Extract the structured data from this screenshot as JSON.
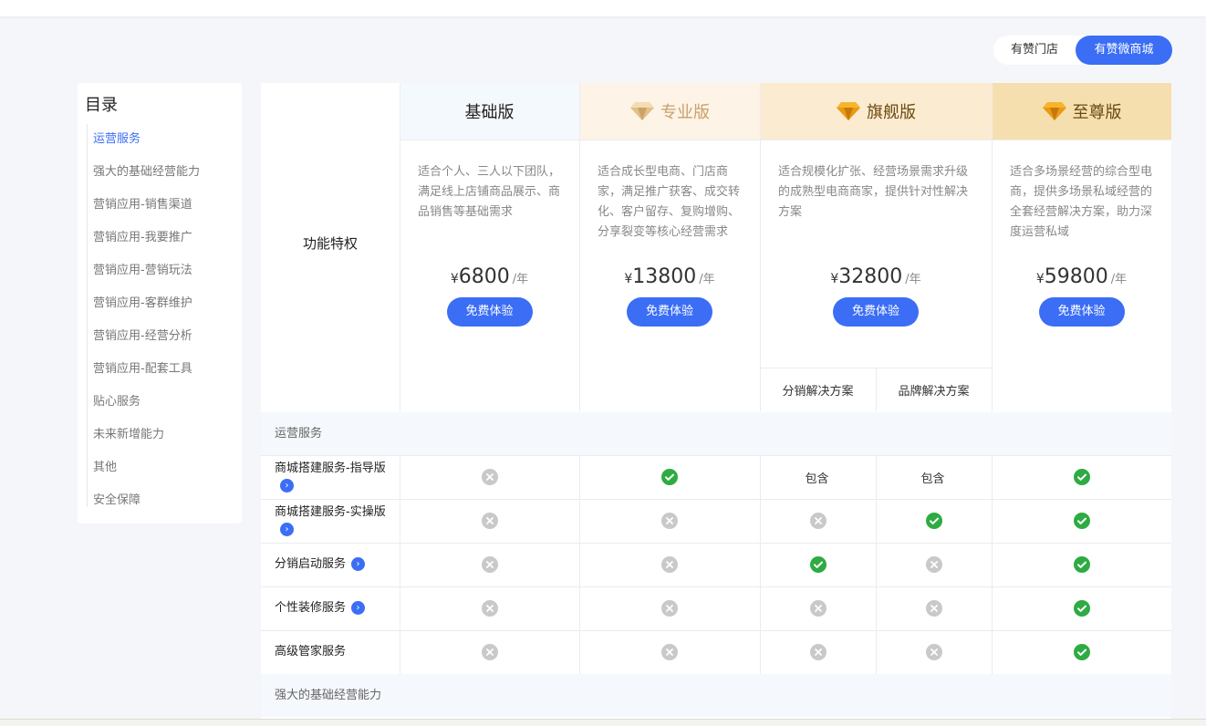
{
  "switcher": {
    "store": "有赞门店",
    "mall": "有赞微商城"
  },
  "toc": {
    "title": "目录",
    "items": [
      "运营服务",
      "强大的基础经营能力",
      "营销应用-销售渠道",
      "营销应用-我要推广",
      "营销应用-营销玩法",
      "营销应用-客群维护",
      "营销应用-经营分析",
      "营销应用-配套工具",
      "贴心服务",
      "未来新增能力",
      "其他",
      "安全保障"
    ]
  },
  "table": {
    "feature_header": "功能特权",
    "try_button": "免费体验",
    "plans": [
      {
        "name": "基础版",
        "desc": "适合个人、三人以下团队，满足线上店铺商品展示、商品销售等基础需求",
        "currency": "¥",
        "price": "6800",
        "unit": "/年",
        "header_bg": "#f4f9fd",
        "icon": ""
      },
      {
        "name": "专业版",
        "desc": "适合成长型电商、门店商家，满足推广获客、成交转化、客户留存、复购增购、分享裂变等核心经营需求",
        "currency": "¥",
        "price": "13800",
        "unit": "/年",
        "header_bg": "#fdf3e6",
        "icon": "diamond-icon"
      },
      {
        "name": "旗舰版",
        "desc": "适合规模化扩张、经营场景需求升级的成熟型电商商家，提供针对性解决方案",
        "currency": "¥",
        "price": "32800",
        "unit": "/年",
        "header_bg": "#fbebd0",
        "icon": "diamond-icon"
      },
      {
        "name": "至尊版",
        "desc": "适合多场景经营的综合型电商，提供多场景私域经营的全套经营解决方案，助力深度运营私域",
        "currency": "¥",
        "price": "59800",
        "unit": "/年",
        "header_bg": "#f6dfae",
        "icon": "diamond-icon"
      }
    ],
    "flagship_sub": [
      "分销解决方案",
      "品牌解决方案"
    ],
    "sections": [
      {
        "title": "运营服务",
        "rows": [
          {
            "label": "商城搭建服务-指导版",
            "info": true,
            "values": [
              "no",
              "yes",
              "包含",
              "包含",
              "yes"
            ]
          },
          {
            "label": "商城搭建服务-实操版",
            "info": true,
            "values": [
              "no",
              "no",
              "no",
              "yes",
              "yes"
            ]
          },
          {
            "label": "分销启动服务",
            "info": true,
            "values": [
              "no",
              "no",
              "yes",
              "no",
              "yes"
            ]
          },
          {
            "label": "个性装修服务",
            "info": true,
            "values": [
              "no",
              "no",
              "no",
              "no",
              "yes"
            ]
          },
          {
            "label": "高级管家服务",
            "info": false,
            "values": [
              "no",
              "no",
              "no",
              "no",
              "yes"
            ]
          }
        ]
      },
      {
        "title": "强大的基础经营能力",
        "rows": []
      }
    ]
  },
  "colors": {
    "accent": "#3b6ef5",
    "check": "#2eab43",
    "cross": "#c9c9c9"
  }
}
